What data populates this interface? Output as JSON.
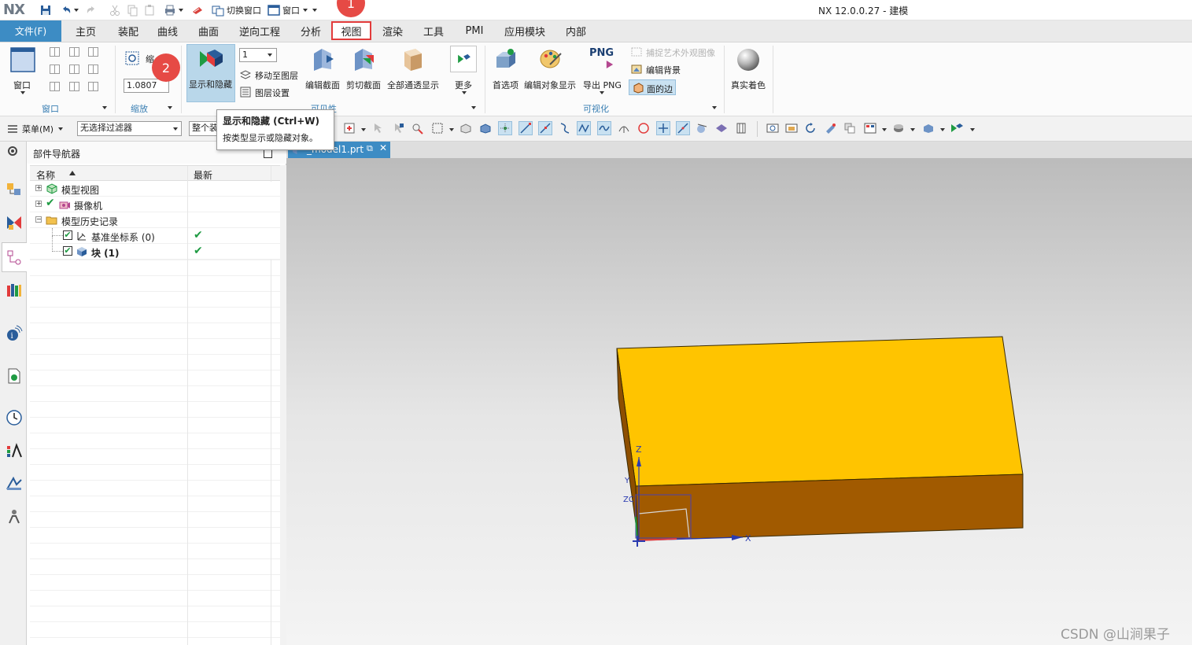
{
  "app": {
    "logo": "NX",
    "title": "NX 12.0.0.27 - 建模"
  },
  "quick_access": {
    "switch_window": "切换窗口",
    "window": "窗口"
  },
  "menu": {
    "file": "文件(F)",
    "tabs": [
      "主页",
      "装配",
      "曲线",
      "曲面",
      "逆向工程",
      "分析",
      "视图",
      "渲染",
      "工具",
      "PMI",
      "应用模块",
      "内部"
    ],
    "active_tab": "视图"
  },
  "ribbon": {
    "window_group": {
      "button": "窗口",
      "label": "窗口"
    },
    "zoom_group": {
      "button": "缩",
      "value": "1.0807",
      "label": "缩放"
    },
    "show_hide": {
      "label": "显示和隐藏"
    },
    "layer": {
      "value": "1",
      "move_to_layer": "移动至图层",
      "layer_settings": "图层设置"
    },
    "section": {
      "edit_section": "编辑截面",
      "clip_section": "剪切截面",
      "all_through_display": "全部通透显示",
      "more": "更多",
      "group_label": "可见性"
    },
    "visual": {
      "preferences": "首选项",
      "edit_object_display": "编辑对象显示",
      "export_png": "导出 PNG",
      "png_text": "PNG",
      "capture_art": "捕捉艺术外观图像",
      "edit_background": "编辑背景",
      "face_edges": "面的边",
      "label": "可视化"
    },
    "true_shading": {
      "label": "真实着色"
    }
  },
  "selection_bar": {
    "menu": "菜单(M)",
    "filter": "无选择过滤器",
    "scope": "整个装"
  },
  "tooltip": {
    "title": "显示和隐藏 (Ctrl+W)",
    "body": "按类型显示或隐藏对象。"
  },
  "navigator": {
    "title": "部件导航器",
    "columns": {
      "name": "名称",
      "latest": "最新"
    },
    "rows": [
      {
        "label": "模型视图",
        "latest": ""
      },
      {
        "label": "摄像机",
        "latest": ""
      },
      {
        "label": "模型历史记录",
        "latest": ""
      },
      {
        "label": "基准坐标系 (0)",
        "latest": "✔"
      },
      {
        "label": "块 (1)",
        "latest": "✔"
      }
    ]
  },
  "viewport": {
    "tab_label": "_model1.prt",
    "axes": {
      "z": "Z",
      "x": "X",
      "y": "Y",
      "zc": "ZC"
    }
  },
  "annotations": {
    "badge1": "1",
    "badge2": "2"
  },
  "watermark": "CSDN @山涧果子",
  "colors": {
    "accent": "#3d8cc4",
    "badge": "#e64a45",
    "block_top": "#ffc400",
    "block_side": "#a15a00"
  }
}
